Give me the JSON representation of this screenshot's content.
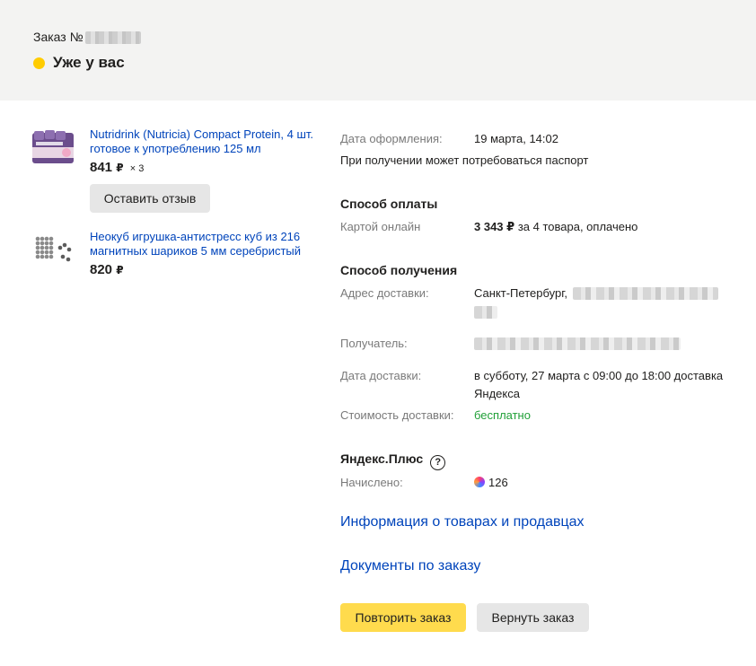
{
  "header": {
    "order_label": "Заказ №",
    "status": "Уже у вас",
    "status_color": "#ffcc00"
  },
  "items": [
    {
      "title": "Nutridrink (Nutricia) Compact Protein, 4 шт. готовое к употреблению 125 мл",
      "price": "841",
      "currency": "₽",
      "qty": "× 3",
      "review_button": "Оставить отзыв",
      "icon": "nutridrink-product-image"
    },
    {
      "title": "Неокуб игрушка-антистресс куб из 216 магнитных шариков 5 мм серебристый",
      "price": "820",
      "currency": "₽",
      "icon": "neocube-product-image"
    }
  ],
  "details": {
    "order_date_label": "Дата оформления:",
    "order_date": "19 марта, 14:02",
    "passport_note": "При получении может потребоваться паспорт",
    "payment_title": "Способ оплаты",
    "payment_method": "Картой онлайн",
    "payment_amount": "3 343 ₽",
    "payment_suffix": " за 4 товара, оплачено",
    "delivery_title": "Способ получения",
    "address_label": "Адрес доставки:",
    "address_value": "Санкт-Петербург,",
    "recipient_label": "Получатель:",
    "delivery_date_label": "Дата доставки:",
    "delivery_date_line1": "в субботу, 27 марта с 09:00 до 18:00 доставка",
    "delivery_date_line2": "Яндекса",
    "delivery_cost_label": "Стоимость доставки:",
    "delivery_cost": "бесплатно",
    "plus_title": "Яндекс.Плюс",
    "plus_help": "?",
    "accrued_label": "Начислено:",
    "accrued_value": "126"
  },
  "links": {
    "products_info": "Информация о товарах и продавцах",
    "documents": "Документы по заказу"
  },
  "buttons": {
    "repeat": "Повторить заказ",
    "return": "Вернуть заказ"
  },
  "colors": {
    "link": "#0044bb",
    "accent_button": "#ffdb4d",
    "free_green": "#21a038"
  }
}
